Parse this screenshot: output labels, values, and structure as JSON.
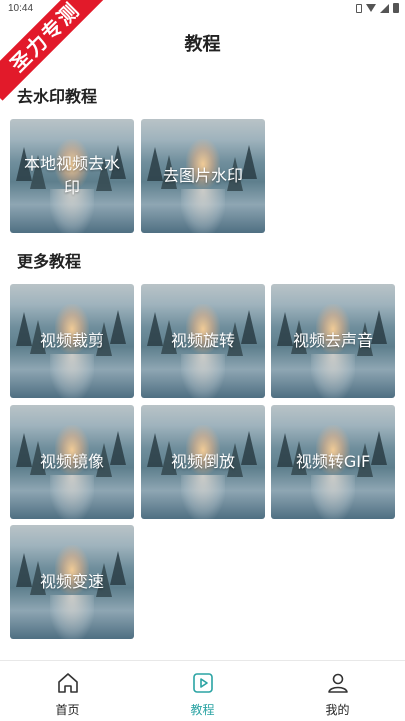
{
  "status_bar": {
    "time": "10:44"
  },
  "ribbon": {
    "text": "圣力专测"
  },
  "page": {
    "title": "教程"
  },
  "sections": [
    {
      "title": "去水印教程",
      "items": [
        "本地视频去水印",
        "去图片水印"
      ]
    },
    {
      "title": "更多教程",
      "items": [
        "视频裁剪",
        "视频旋转",
        "视频去声音",
        "视频镜像",
        "视频倒放",
        "视频转GIF",
        "视频变速"
      ]
    }
  ],
  "tab_bar": {
    "tabs": [
      {
        "label": "首页",
        "icon": "home-icon",
        "active": false
      },
      {
        "label": "教程",
        "icon": "play-icon",
        "active": true
      },
      {
        "label": "我的",
        "icon": "user-icon",
        "active": false
      }
    ],
    "active_color": "#2aa3a3"
  },
  "colors": {
    "ribbon": "#e21a2a",
    "accent": "#2aa3a3"
  }
}
